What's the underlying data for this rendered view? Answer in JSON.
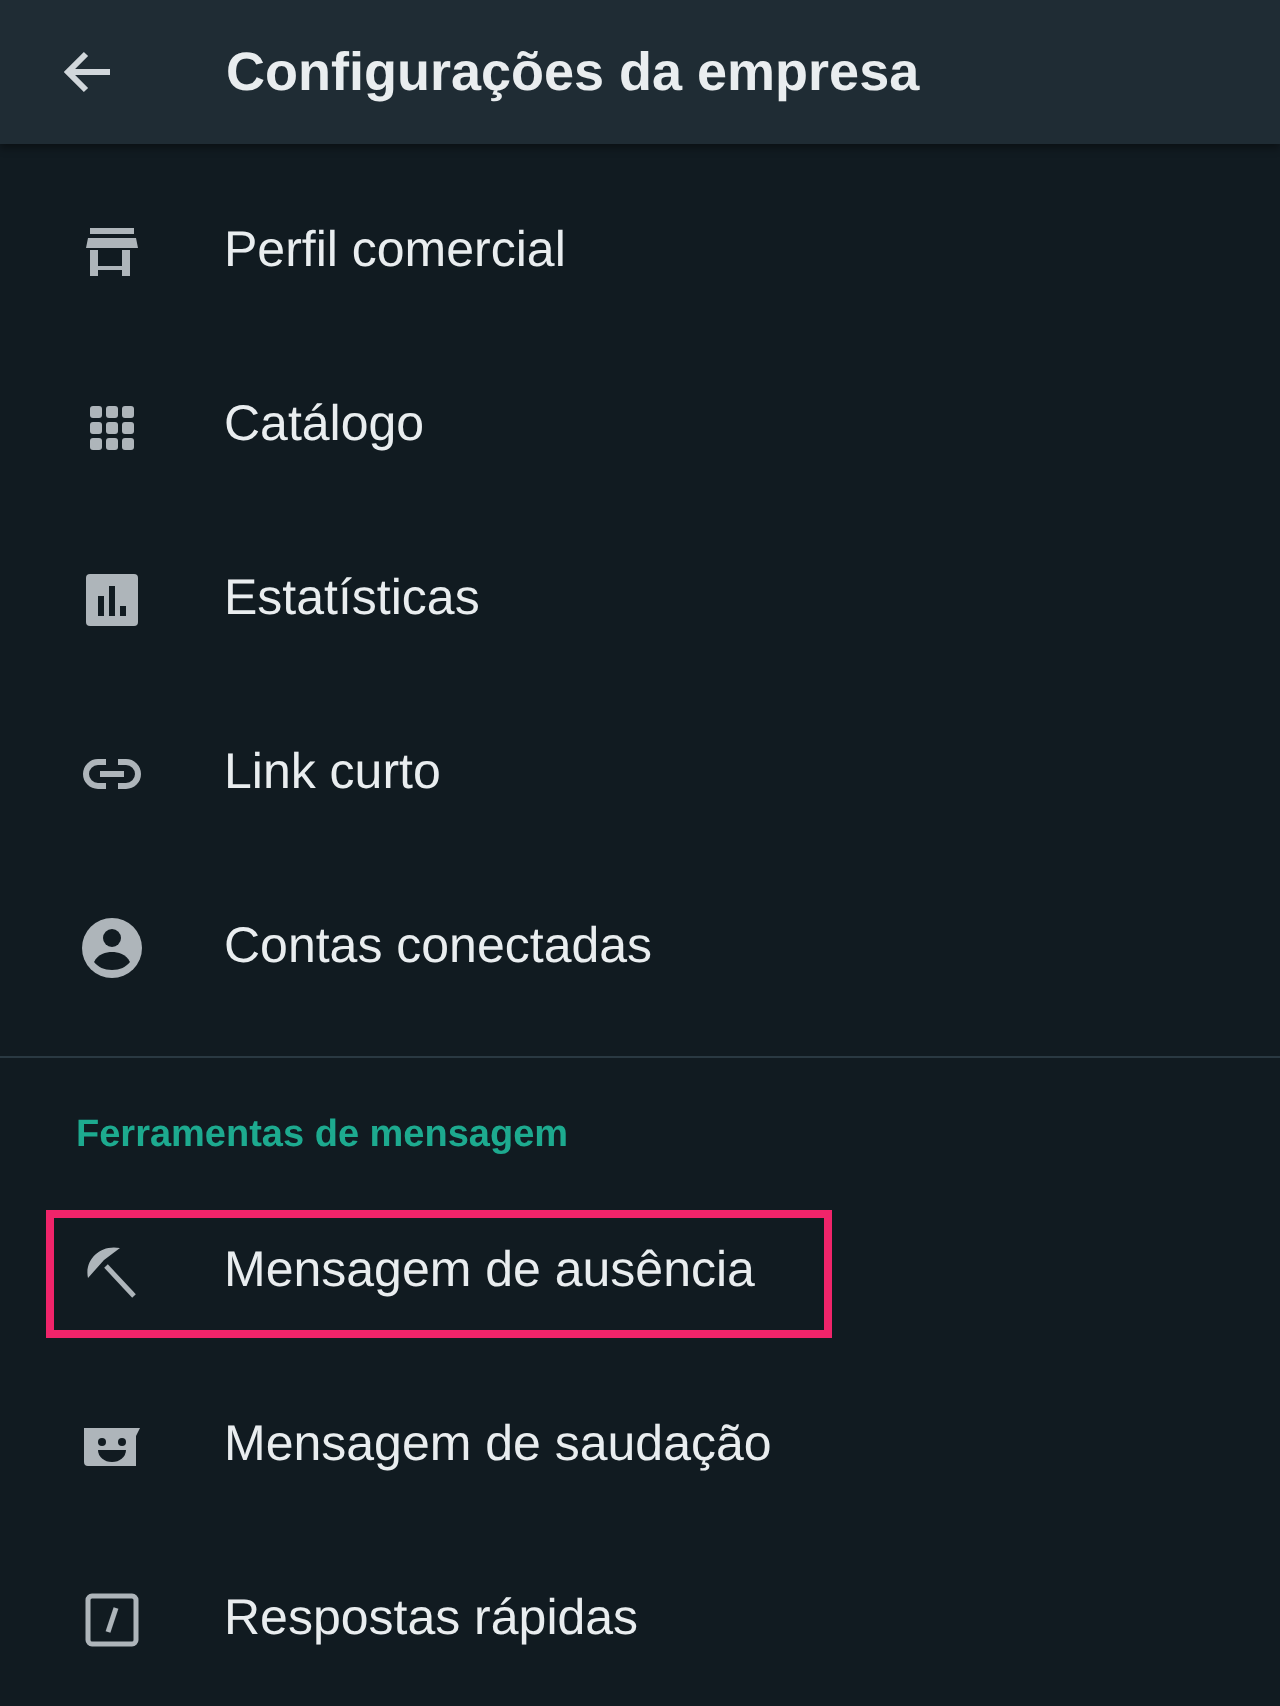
{
  "header": {
    "title": "Configurações da empresa"
  },
  "items": [
    {
      "label": "Perfil comercial",
      "highlighted": false
    },
    {
      "label": "Catálogo",
      "highlighted": false
    },
    {
      "label": "Estatísticas",
      "highlighted": false
    },
    {
      "label": "Link curto",
      "highlighted": false
    },
    {
      "label": "Contas conectadas",
      "highlighted": false
    }
  ],
  "section": {
    "title": "Ferramentas de mensagem",
    "items": [
      {
        "label": "Mensagem de ausência",
        "highlighted": true
      },
      {
        "label": "Mensagem de saudação",
        "highlighted": false
      },
      {
        "label": "Respostas rápidas",
        "highlighted": false
      }
    ]
  }
}
